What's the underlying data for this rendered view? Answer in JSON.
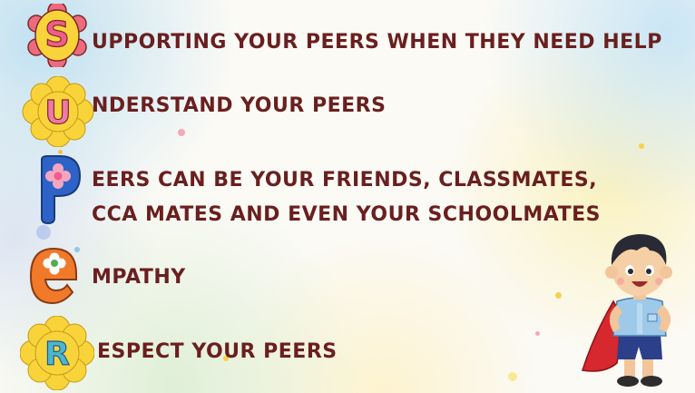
{
  "letters": {
    "s": "S",
    "u": "U",
    "p": "P",
    "e": "e",
    "r": "R"
  },
  "lines": {
    "supporting": "UPPORTING YOUR PEERS WHEN THEY NEED HELP",
    "understand": "NDERSTAND YOUR PEERS",
    "peers_1": "EERS CAN BE YOUR FRIENDS, CLASSMATES,",
    "peers_2": "CCA MATES AND EVEN YOUR SCHOOLMATES",
    "empathy": "MPATHY",
    "respect": "ESPECT YOUR PEERS"
  },
  "colors": {
    "text": "#6a1f1f",
    "flower_yellow": "#f8d43a",
    "letter_pink": "#ef5d8c",
    "letter_blue": "#2d63c8",
    "letter_orange": "#f07a2a",
    "letter_teal": "#4bb7cf"
  }
}
